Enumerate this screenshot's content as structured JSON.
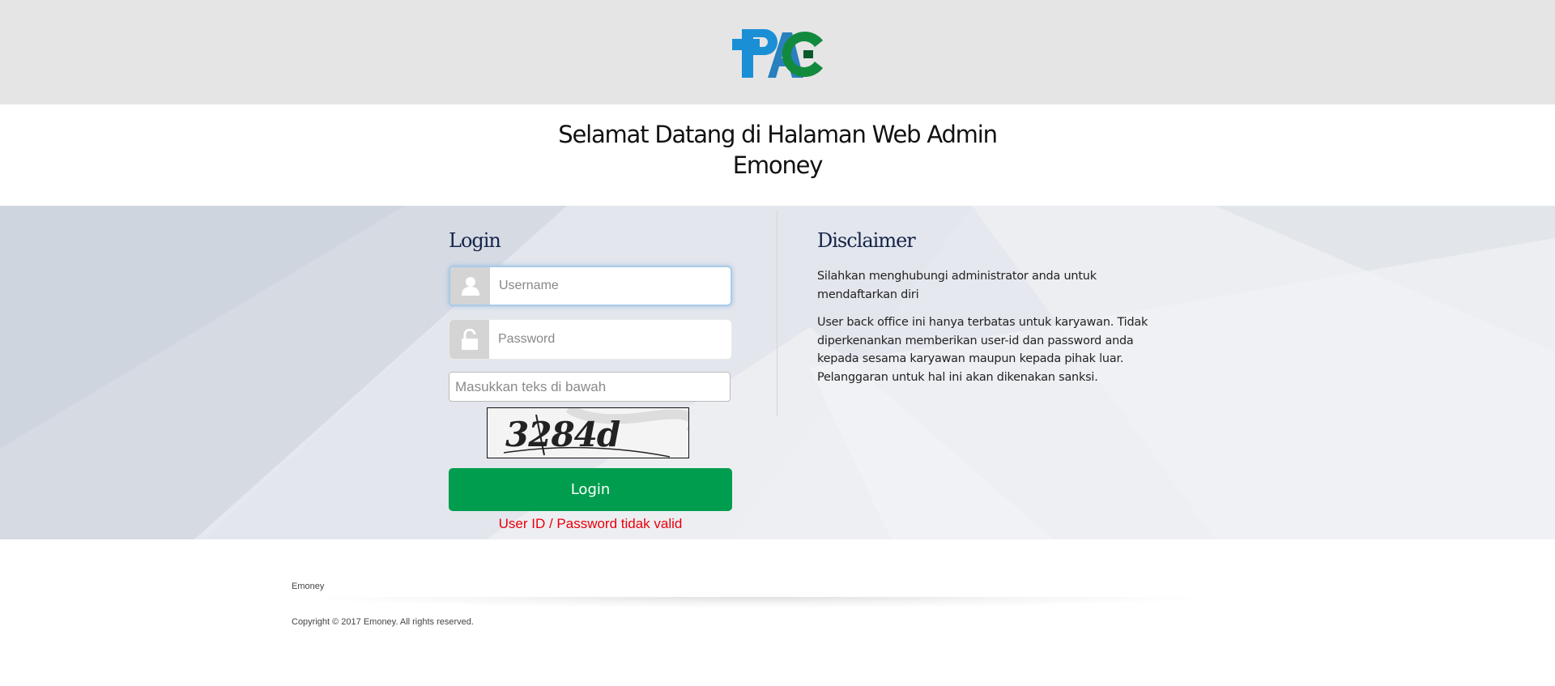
{
  "header": {
    "logo_text": "PAC"
  },
  "welcome": {
    "line1": "Selamat Datang di Halaman Web Admin",
    "line2": "Emoney"
  },
  "login": {
    "heading": "Login",
    "username_placeholder": "Username",
    "password_placeholder": "Password",
    "captcha_placeholder": "Masukkan teks di bawah",
    "captcha_text": "3284d",
    "button_label": "Login",
    "error_message": "User ID / Password tidak valid"
  },
  "disclaimer": {
    "heading": "Disclaimer",
    "paragraph1": "Silahkan menghubungi administrator anda untuk mendaftarkan diri",
    "paragraph2": "User back office ini hanya terbatas untuk karyawan. Tidak diperkenankan memberikan user-id dan password anda kepada sesama karyawan maupun kepada pihak luar. Pelanggaran untuk hal ini akan dikenakan sanksi."
  },
  "footer": {
    "brand": "Emoney",
    "copyright": "Copyright © 2017 Emoney. All rights reserved."
  },
  "colors": {
    "header_bg": "#e6e5e6",
    "login_button": "#009d4e",
    "error_text": "#e8000b",
    "heading_text": "#15244a",
    "logo_blue": "#1a8fd6",
    "logo_green": "#128a3e"
  },
  "icons": [
    "user-icon",
    "lock-icon"
  ]
}
